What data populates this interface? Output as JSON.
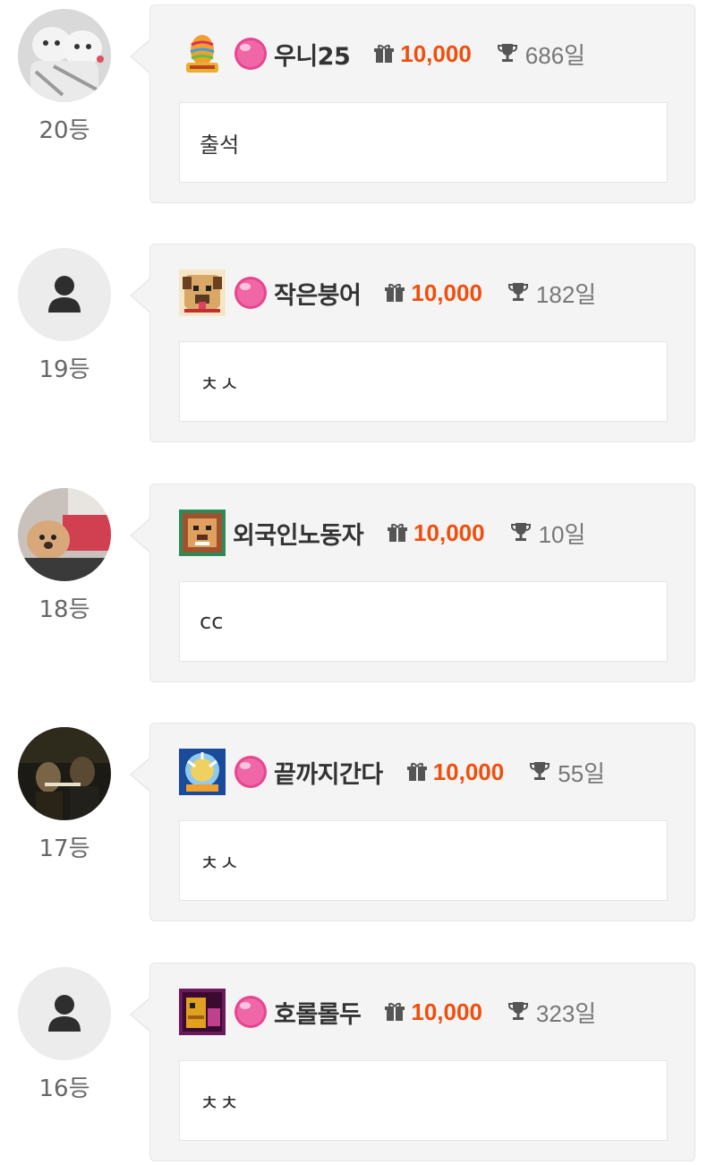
{
  "entries": [
    {
      "rank": "20등",
      "avatar": "dog-photo-avatar",
      "level_icon": "easter-egg-level-icon",
      "candy": true,
      "nickname": "우니25",
      "points": "10,000",
      "days": "686일",
      "comment": "출석"
    },
    {
      "rank": "19등",
      "avatar": "default-user-avatar",
      "level_icon": "pug-level-icon",
      "candy": true,
      "nickname": "작은붕어",
      "points": "10,000",
      "days": "182일",
      "comment": "ㅊㅅ"
    },
    {
      "rank": "18등",
      "avatar": "puppy-photo-avatar",
      "level_icon": "lion-level-icon",
      "candy": false,
      "nickname": "외국인노동자",
      "points": "10,000",
      "days": "10일",
      "comment": "cc"
    },
    {
      "rank": "17등",
      "avatar": "movie-still-avatar",
      "level_icon": "dragon-shield-level-icon",
      "candy": true,
      "nickname": "끝까지간다",
      "points": "10,000",
      "days": "55일",
      "comment": "ㅊㅅ"
    },
    {
      "rank": "16등",
      "avatar": "default-user-avatar",
      "level_icon": "monster-level-icon",
      "candy": true,
      "nickname": "호롤롤두",
      "points": "10,000",
      "days": "323일",
      "comment": "ㅊㅊ"
    }
  ],
  "icons": {
    "gift": "gift-icon",
    "trophy": "trophy-icon",
    "candy": "pink-candy-icon"
  },
  "colors": {
    "points": "#f04e0c",
    "bubble_bg": "#f4f4f4",
    "avatar_bg": "#ececec"
  }
}
